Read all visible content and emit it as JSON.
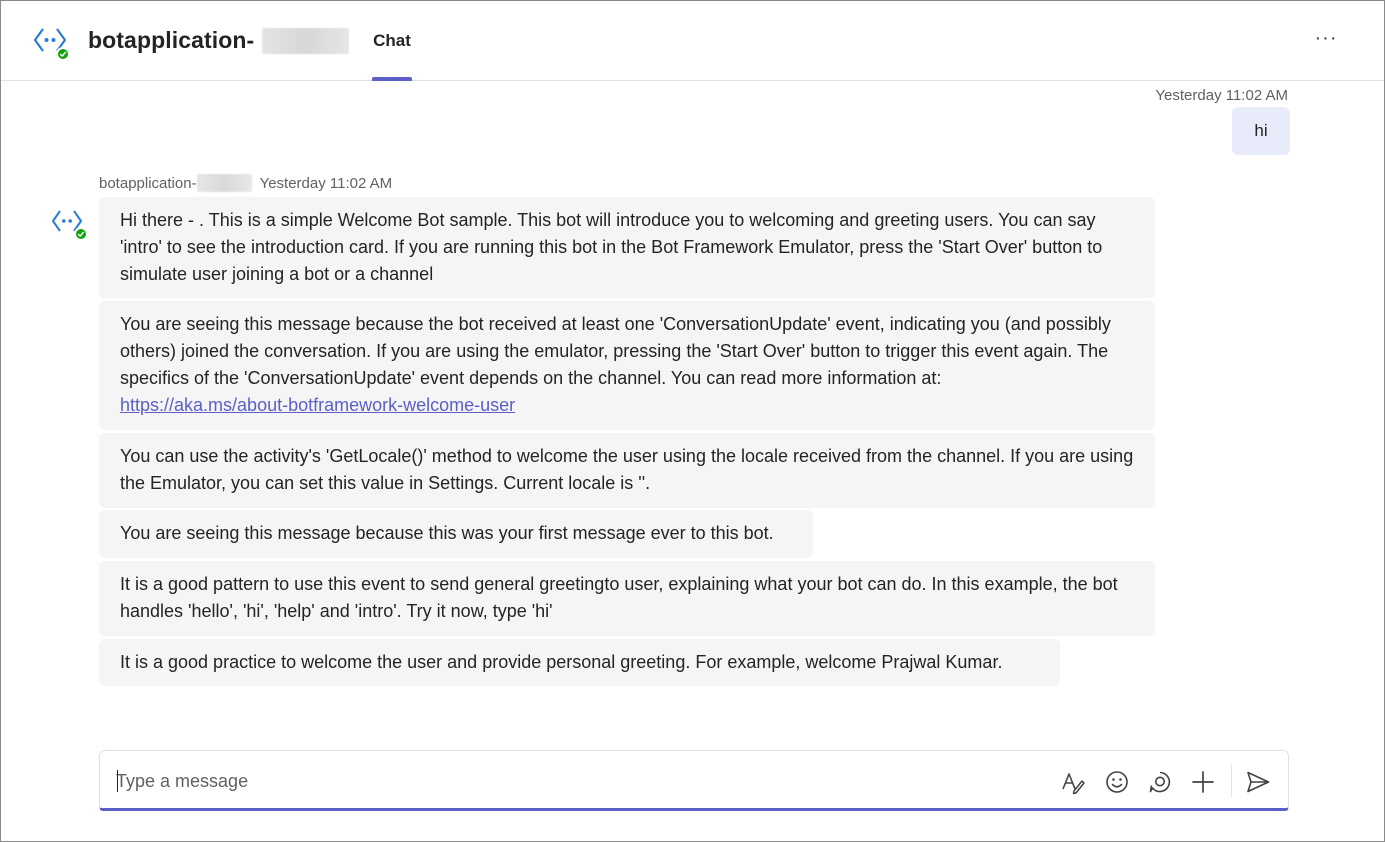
{
  "header": {
    "app_title": "botapplication-",
    "tab_chat": "Chat",
    "more_label": "···"
  },
  "user_message": {
    "time": "Yesterday 11:02 AM",
    "text": "hi"
  },
  "bot": {
    "sender": "botapplication-",
    "time": "Yesterday 11:02 AM",
    "messages": [
      "Hi there - . This is a simple Welcome Bot sample. This bot will introduce you to welcoming and greeting users. You can say 'intro' to see the introduction card. If you are running this bot in the Bot Framework Emulator, press the 'Start Over' button to simulate user joining a bot or a channel",
      "You are seeing this message because the bot received at least one 'ConversationUpdate' event, indicating you (and possibly others) joined the conversation. If you are using the emulator, pressing the 'Start Over' button to trigger this event again. The specifics of the 'ConversationUpdate' event depends on the channel. You can read more information at:",
      "You can use the activity's 'GetLocale()' method to welcome the user using the locale received from the channel. If you are using the Emulator, you can set this value in Settings. Current locale is ''.",
      "You are seeing this message because this was your first message ever to this bot.",
      "It is a good pattern to use this event to send general greetingto user, explaining what your bot can do. In this example, the bot handles 'hello', 'hi', 'help' and 'intro'. Try it now, type 'hi'",
      "It is a good practice to welcome the user and provide personal greeting. For example, welcome Prajwal Kumar."
    ],
    "link": "https://aka.ms/about-botframework-welcome-user"
  },
  "compose": {
    "placeholder": "Type a message",
    "icons": [
      "format-icon",
      "emoji-icon",
      "loop-icon",
      "attach-plus-icon",
      "send-icon"
    ]
  },
  "colors": {
    "accent": "#5b5fc7",
    "presence": "#13a10e",
    "bot_icon": "#2b7cd3",
    "bot_bubble": "#f5f5f5",
    "my_bubble": "#e8ebfa"
  }
}
